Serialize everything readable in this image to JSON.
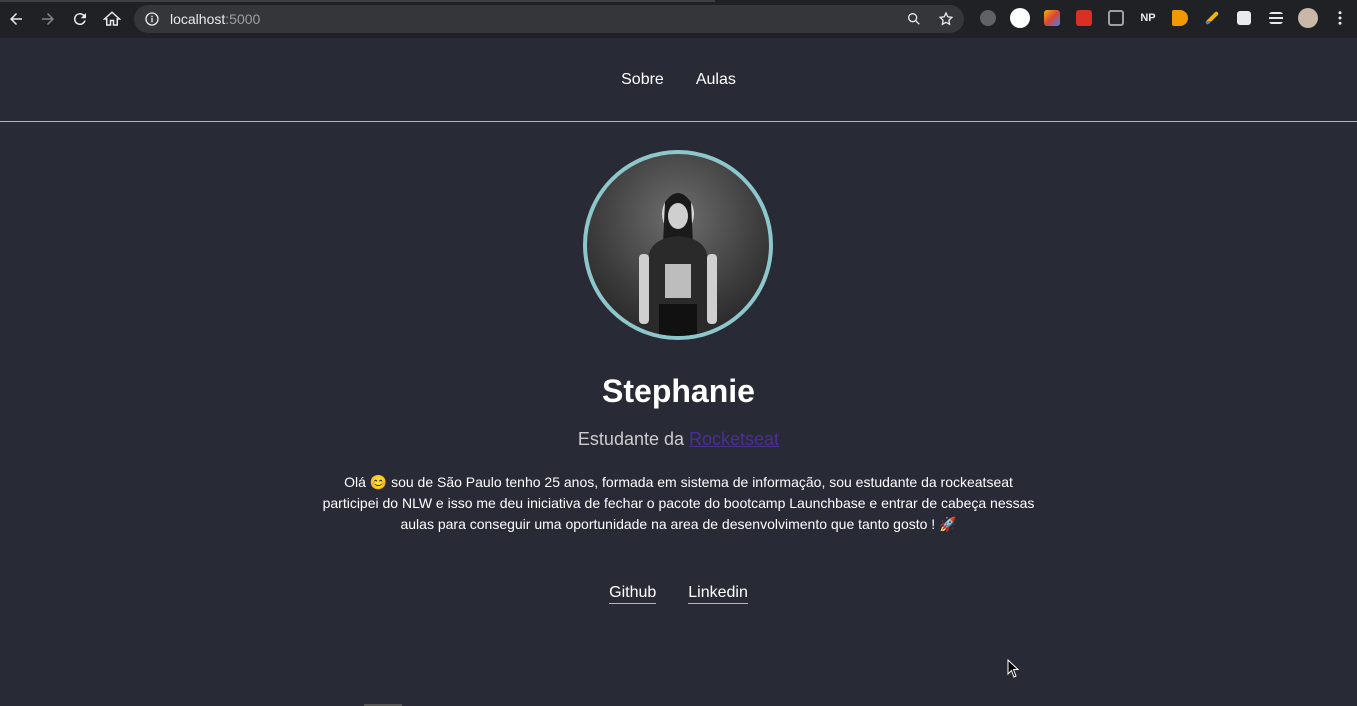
{
  "browser": {
    "url_host": "localhost",
    "url_port": ":5000",
    "extensions": [
      "extension-badge-icon",
      "extension-circle-icon",
      "extension-color-icon",
      "extension-red-icon",
      "extension-frame-icon",
      "NP",
      "extension-arrow-icon",
      "extension-pen-icon",
      "puzzle-icon",
      "media-icon",
      "profile-avatar"
    ]
  },
  "nav": {
    "items": [
      {
        "label": "Sobre"
      },
      {
        "label": "Aulas"
      }
    ]
  },
  "profile": {
    "name": "Stephanie",
    "subtitle_prefix": "Estudante da ",
    "subtitle_link": "Rocketseat",
    "bio": "Olá 😊 sou de São Paulo tenho 25 anos, formada em sistema de informação, sou estudante da rockeatseat participei do NLW e isso me deu iniciativa de fechar o pacote do bootcamp Launchbase e entrar de cabeça nessas aulas para conseguir uma oportunidade na area de desenvolvimento que tanto gosto ! 🚀"
  },
  "links": [
    {
      "label": "Github"
    },
    {
      "label": "Linkedin"
    }
  ],
  "colors": {
    "background": "#282a36",
    "accent": "#8ec7cb",
    "link": "#4c2e99"
  }
}
